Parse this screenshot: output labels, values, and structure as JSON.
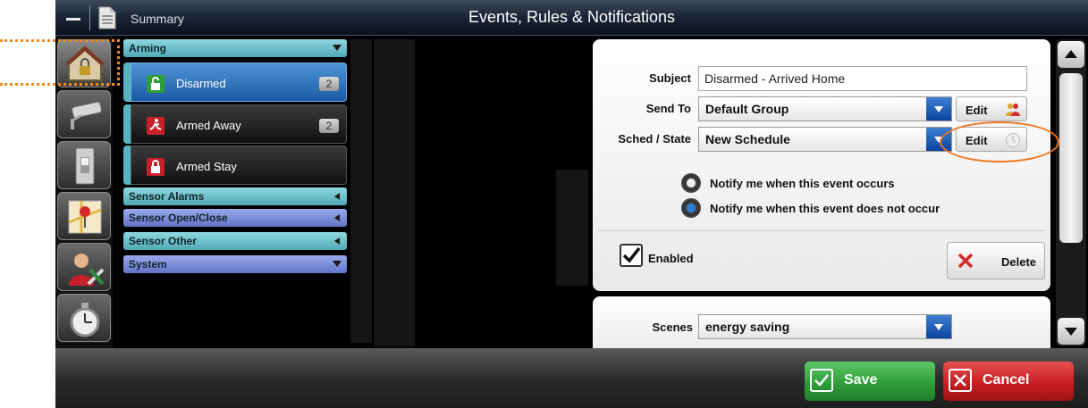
{
  "titlebar": {
    "summary_label": "Summary",
    "title": "Events, Rules & Notifications"
  },
  "rail": {
    "items": [
      {
        "icon": "house-lock-icon",
        "selected": true
      },
      {
        "icon": "security-camera-icon",
        "selected": false
      },
      {
        "icon": "light-switch-icon",
        "selected": false
      },
      {
        "icon": "map-pin-icon",
        "selected": false
      },
      {
        "icon": "user-tools-icon",
        "selected": false
      },
      {
        "icon": "stopwatch-icon",
        "selected": false
      }
    ]
  },
  "list": {
    "categories": [
      {
        "label": "Arming",
        "expanded": true
      },
      {
        "label": "Sensor Alarms",
        "expanded": false
      },
      {
        "label": "Sensor Open/Close",
        "expanded": false
      },
      {
        "label": "Sensor Other",
        "expanded": false
      },
      {
        "label": "System",
        "expanded": true
      }
    ],
    "events": [
      {
        "label": "Disarmed",
        "count": "2",
        "selected": true,
        "icon": "unlock-icon",
        "color": "#2f9e3a"
      },
      {
        "label": "Armed Away",
        "count": "2",
        "selected": false,
        "icon": "running-man-icon",
        "color": "#c8202a"
      },
      {
        "label": "Armed Stay",
        "count": "",
        "selected": false,
        "icon": "lock-icon",
        "color": "#c8202a"
      }
    ]
  },
  "form": {
    "subject_label": "Subject",
    "subject_value": "Disarmed - Arrived Home",
    "send_to_label": "Send To",
    "send_to_value": "Default Group",
    "sched_label": "Sched / State",
    "sched_value": "New Schedule",
    "edit_label": "Edit",
    "radio_occurs": "Notify me when this event occurs",
    "radio_not_occurs": "Notify me when this event does not occur",
    "radio_selected": "not_occurs",
    "enabled_label": "Enabled",
    "enabled": true,
    "delete_label": "Delete",
    "scenes_label": "Scenes",
    "scenes_value": "energy saving"
  },
  "bottom": {
    "save_label": "Save",
    "cancel_label": "Cancel"
  },
  "colors": {
    "accent_blue": "#1a5aa3",
    "save_green": "#2e9d3a",
    "cancel_red": "#c81e22",
    "highlight_orange": "#f0761e"
  }
}
